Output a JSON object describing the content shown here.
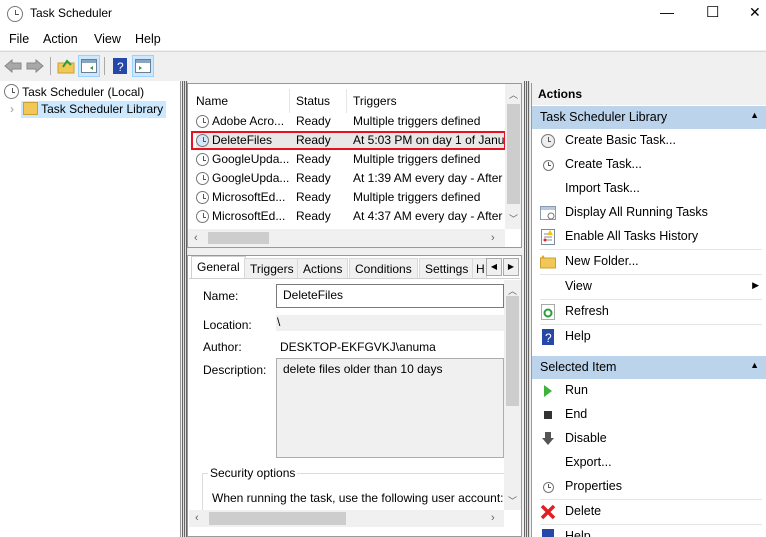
{
  "window": {
    "title": "Task Scheduler",
    "controls": {
      "minimize": "—",
      "maximize": "☐",
      "close": "✕"
    }
  },
  "menu": [
    "File",
    "Action",
    "View",
    "Help"
  ],
  "toolbar": {
    "icons": [
      "back-icon",
      "forward-icon",
      "up-folder-icon",
      "show-hide-console-tree-icon",
      "help-icon",
      "show-hide-action-pane-icon"
    ]
  },
  "tree": {
    "root": "Task Scheduler (Local)",
    "child": "Task Scheduler Library",
    "expander": "›"
  },
  "tasks": {
    "columns": [
      "Name",
      "Status",
      "Triggers"
    ],
    "rows": [
      {
        "name": "Adobe Acro...",
        "status": "Ready",
        "triggers": "Multiple triggers defined"
      },
      {
        "name": "DeleteFiles",
        "status": "Ready",
        "triggers": "At 5:03 PM  on day 1 of Janu"
      },
      {
        "name": "GoogleUpda...",
        "status": "Ready",
        "triggers": "Multiple triggers defined"
      },
      {
        "name": "GoogleUpda...",
        "status": "Ready",
        "triggers": "At 1:39 AM every day - After"
      },
      {
        "name": "MicrosoftEd...",
        "status": "Ready",
        "triggers": "Multiple triggers defined"
      },
      {
        "name": "MicrosoftEd...",
        "status": "Ready",
        "triggers": "At 4:37 AM every day - After"
      }
    ],
    "highlighted_row": "DeleteFiles"
  },
  "detail": {
    "tabs": [
      "General",
      "Triggers",
      "Actions",
      "Conditions",
      "Settings",
      "H"
    ],
    "active_tab": "General",
    "name_label": "Name:",
    "name_value": "DeleteFiles",
    "location_label": "Location:",
    "location_value": "\\",
    "author_label": "Author:",
    "author_value": "DESKTOP-EKFGVKJ\\anuma",
    "description_label": "Description:",
    "description_value": "delete files older than 10 days",
    "security_group": "Security options",
    "security_text": "When running the task, use the following user account:"
  },
  "actions": {
    "header": "Actions",
    "section1": "Task Scheduler Library",
    "section1_items": [
      "Create Basic Task...",
      "Create Task...",
      "Import Task...",
      "Display All Running Tasks",
      "Enable All Tasks History",
      "New Folder...",
      "View",
      "Refresh",
      "Help"
    ],
    "section2": "Selected Item",
    "section2_items": [
      "Run",
      "End",
      "Disable",
      "Export...",
      "Properties",
      "Delete",
      "Help"
    ]
  },
  "colors": {
    "accent_selected": "#cce8ff",
    "section_header": "#bcd3ec",
    "highlight_box": "#e81123"
  }
}
